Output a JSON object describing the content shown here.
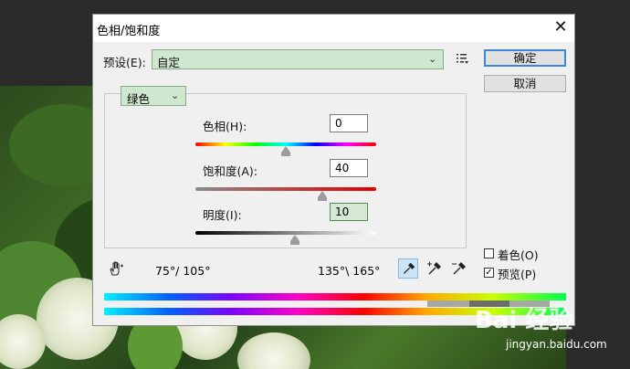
{
  "dialog": {
    "title": "色相/饱和度",
    "close_glyph": "✕"
  },
  "preset": {
    "label": "预设(E):",
    "value": "自定"
  },
  "buttons": {
    "ok": "确定",
    "cancel": "取消"
  },
  "channel": {
    "value": "绿色"
  },
  "hue": {
    "label": "色相(H):",
    "value": "0"
  },
  "saturation": {
    "label": "饱和度(A):",
    "value": "40"
  },
  "lightness": {
    "label": "明度(I):",
    "value": "10"
  },
  "ranges": {
    "left": "75°/ 105°",
    "right": "135°\\ 165°"
  },
  "options": {
    "colorize_label": "着色(O)",
    "colorize_checked": false,
    "preview_label": "预览(P)",
    "preview_checked": true,
    "check_glyph": "✓"
  },
  "icons": {
    "hand": "hand-icon",
    "eyedropper": "eyedropper-icon",
    "eyedropper_plus": "eyedropper-plus-icon",
    "eyedropper_minus": "eyedropper-minus-icon",
    "preset_menu": "preset-menu-icon"
  },
  "watermark": {
    "logo": "Bai 经验",
    "url": "jingyan.baidu.com"
  }
}
